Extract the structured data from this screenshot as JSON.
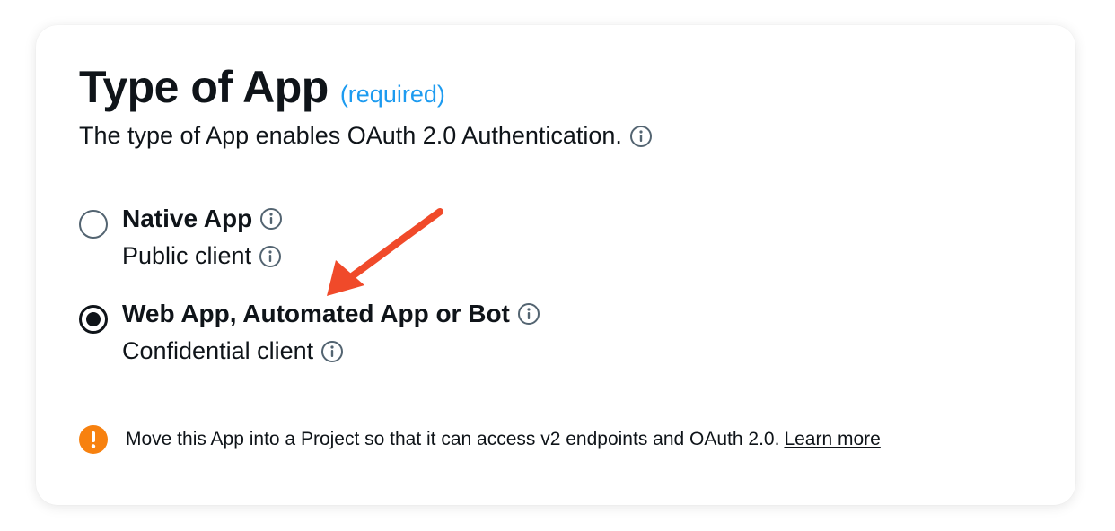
{
  "card": {
    "title": "Type of App",
    "required_label": "(required)",
    "subtitle": "The type of App enables OAuth 2.0 Authentication."
  },
  "options": [
    {
      "title": "Native App",
      "subtitle": "Public client",
      "selected": false
    },
    {
      "title": "Web App, Automated App or Bot",
      "subtitle": "Confidential client",
      "selected": true
    }
  ],
  "notice": {
    "text": "Move this App into a Project so that it can access v2 endpoints and OAuth 2.0.",
    "link_label": "Learn more",
    "icon": "warning-icon"
  },
  "icons": {
    "info": "info-icon",
    "annotation": "arrow-annotation"
  },
  "colors": {
    "text": "#0f1419",
    "link_blue": "#1d9bf0",
    "icon_gray": "#536471",
    "warning_orange": "#f7810f",
    "arrow_red": "#f04a2a"
  }
}
